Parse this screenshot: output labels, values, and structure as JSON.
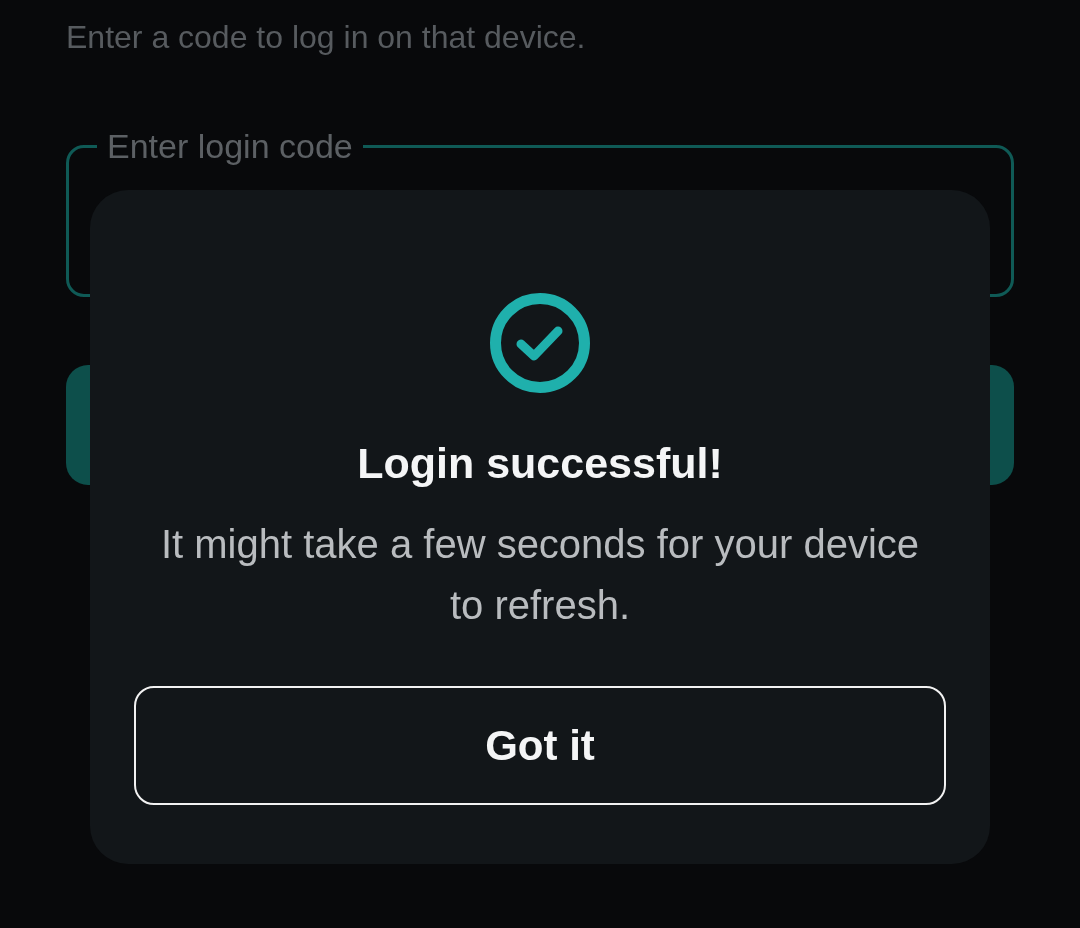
{
  "instruction": "Enter a code to log in on that device.",
  "code_field": {
    "label": "Enter login code"
  },
  "dialog": {
    "title": "Login successful!",
    "message": "It might take a few seconds for your device to refresh.",
    "button": "Got it"
  }
}
